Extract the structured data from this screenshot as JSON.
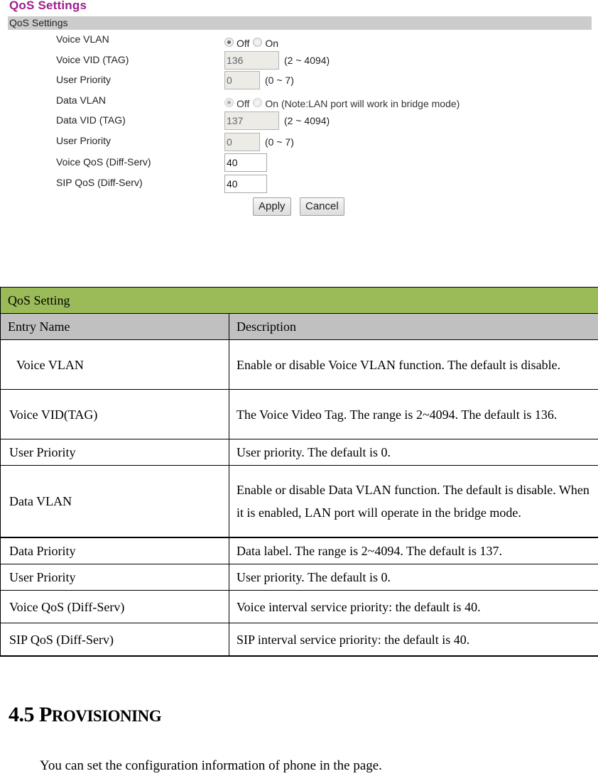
{
  "ui": {
    "page_title": "QoS Settings",
    "section_bar": "QoS Settings",
    "fields": {
      "voice_vlan": {
        "label": "Voice VLAN",
        "options": [
          "Off",
          "On"
        ],
        "selected": "Off"
      },
      "voice_vid": {
        "label": "Voice VID (TAG)",
        "value": "136",
        "hint": "(2 ~ 4094)"
      },
      "voice_user_priority": {
        "label": "User Priority",
        "value": "0",
        "hint": "(0 ~ 7)"
      },
      "data_vlan": {
        "label": "Data VLAN",
        "options": [
          "Off",
          "On (Note:LAN port will work in bridge mode)"
        ],
        "selected": "Off"
      },
      "data_vid": {
        "label": "Data VID (TAG)",
        "value": "137",
        "hint": "(2 ~ 4094)"
      },
      "data_user_priority": {
        "label": "User Priority",
        "value": "0",
        "hint": "(0 ~ 7)"
      },
      "voice_qos": {
        "label": "Voice QoS (Diff-Serv)",
        "value": "40"
      },
      "sip_qos": {
        "label": "SIP QoS (Diff-Serv)",
        "value": "40"
      }
    },
    "buttons": {
      "apply": "Apply",
      "cancel": "Cancel"
    },
    "colors": {
      "title": "#9b1e8c",
      "bar": "#cccccc"
    }
  },
  "table": {
    "section_title": "QoS Setting",
    "headers": [
      "Entry Name",
      "Description"
    ],
    "rows": [
      {
        "name": "Voice VLAN",
        "description": "Enable or disable Voice VLAN function. The default is disable."
      },
      {
        "name": "Voice VID(TAG)",
        "description": "The Voice Video Tag. The range is 2~4094. The default is 136."
      },
      {
        "name": "User Priority",
        "description": "User priority. The default is 0."
      },
      {
        "name": "Data VLAN",
        "description": "Enable or disable Data VLAN function. The default is disable. When it is enabled, LAN port will operate in the bridge mode."
      },
      {
        "name": "Data Priority",
        "description": "Data label. The range is 2~4094. The default is 137."
      },
      {
        "name": "User Priority",
        "description": "User priority. The default is 0."
      },
      {
        "name": "Voice QoS (Diff-Serv)",
        "description": "Voice interval service priority: the default is 40."
      },
      {
        "name": "SIP QoS (Diff-Serv)",
        "description": "SIP interval service priority: the default is 40."
      }
    ],
    "colors": {
      "section": "#9bbb59",
      "header": "#c0c0c0"
    }
  },
  "section": {
    "number": "4.5",
    "title_initial": "P",
    "title_rest": "ROVISIONING",
    "paragraph": "You can set the configuration information of phone in the page."
  }
}
